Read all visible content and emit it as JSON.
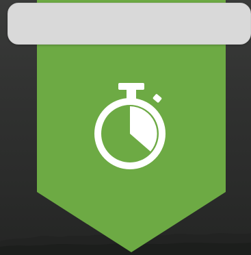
{
  "colors": {
    "top_bar": "#d9d9d9",
    "pennant": "#6daa44",
    "icon": "#ffffff",
    "background_dark": "#2e2f2e"
  },
  "top_bar": {
    "text": ""
  },
  "badge": {
    "icon": "stopwatch-icon"
  }
}
